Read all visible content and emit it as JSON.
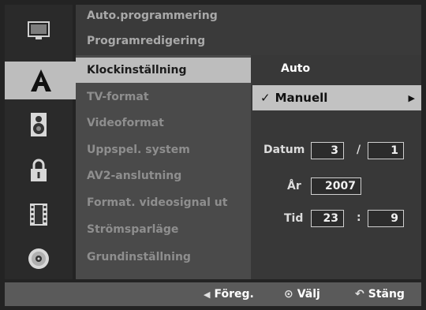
{
  "top_menu": [
    {
      "label": "Auto.programmering"
    },
    {
      "label": "Programredigering"
    }
  ],
  "menu_items": [
    {
      "label": "Klockinställning",
      "selected": true
    },
    {
      "label": "TV-format"
    },
    {
      "label": "Videoformat"
    },
    {
      "label": "Uppspel. system"
    },
    {
      "label": "AV2-anslutning"
    },
    {
      "label": "Format. videosignal ut"
    },
    {
      "label": "Strömsparläge"
    },
    {
      "label": "Grundinställning"
    }
  ],
  "rail_icons": [
    {
      "name": "tv-icon"
    },
    {
      "name": "language-a-icon",
      "active": true
    },
    {
      "name": "speaker-icon"
    },
    {
      "name": "lock-icon"
    },
    {
      "name": "film-icon"
    },
    {
      "name": "disc-icon"
    }
  ],
  "options": {
    "auto": "Auto",
    "manual": "Manuell",
    "manual_check": "✓",
    "manual_arrow": "▶"
  },
  "clock": {
    "date_label": "Datum",
    "day": "3",
    "date_sep": "/",
    "month": "1",
    "year_label": "År",
    "year": "2007",
    "time_label": "Tid",
    "hour": "23",
    "time_sep": ":",
    "minute": "9"
  },
  "footer": {
    "back_icon": "◀",
    "back": "Föreg.",
    "select_icon": "⊙",
    "select": "Välj",
    "close_icon": "↶",
    "close": "Stäng"
  }
}
